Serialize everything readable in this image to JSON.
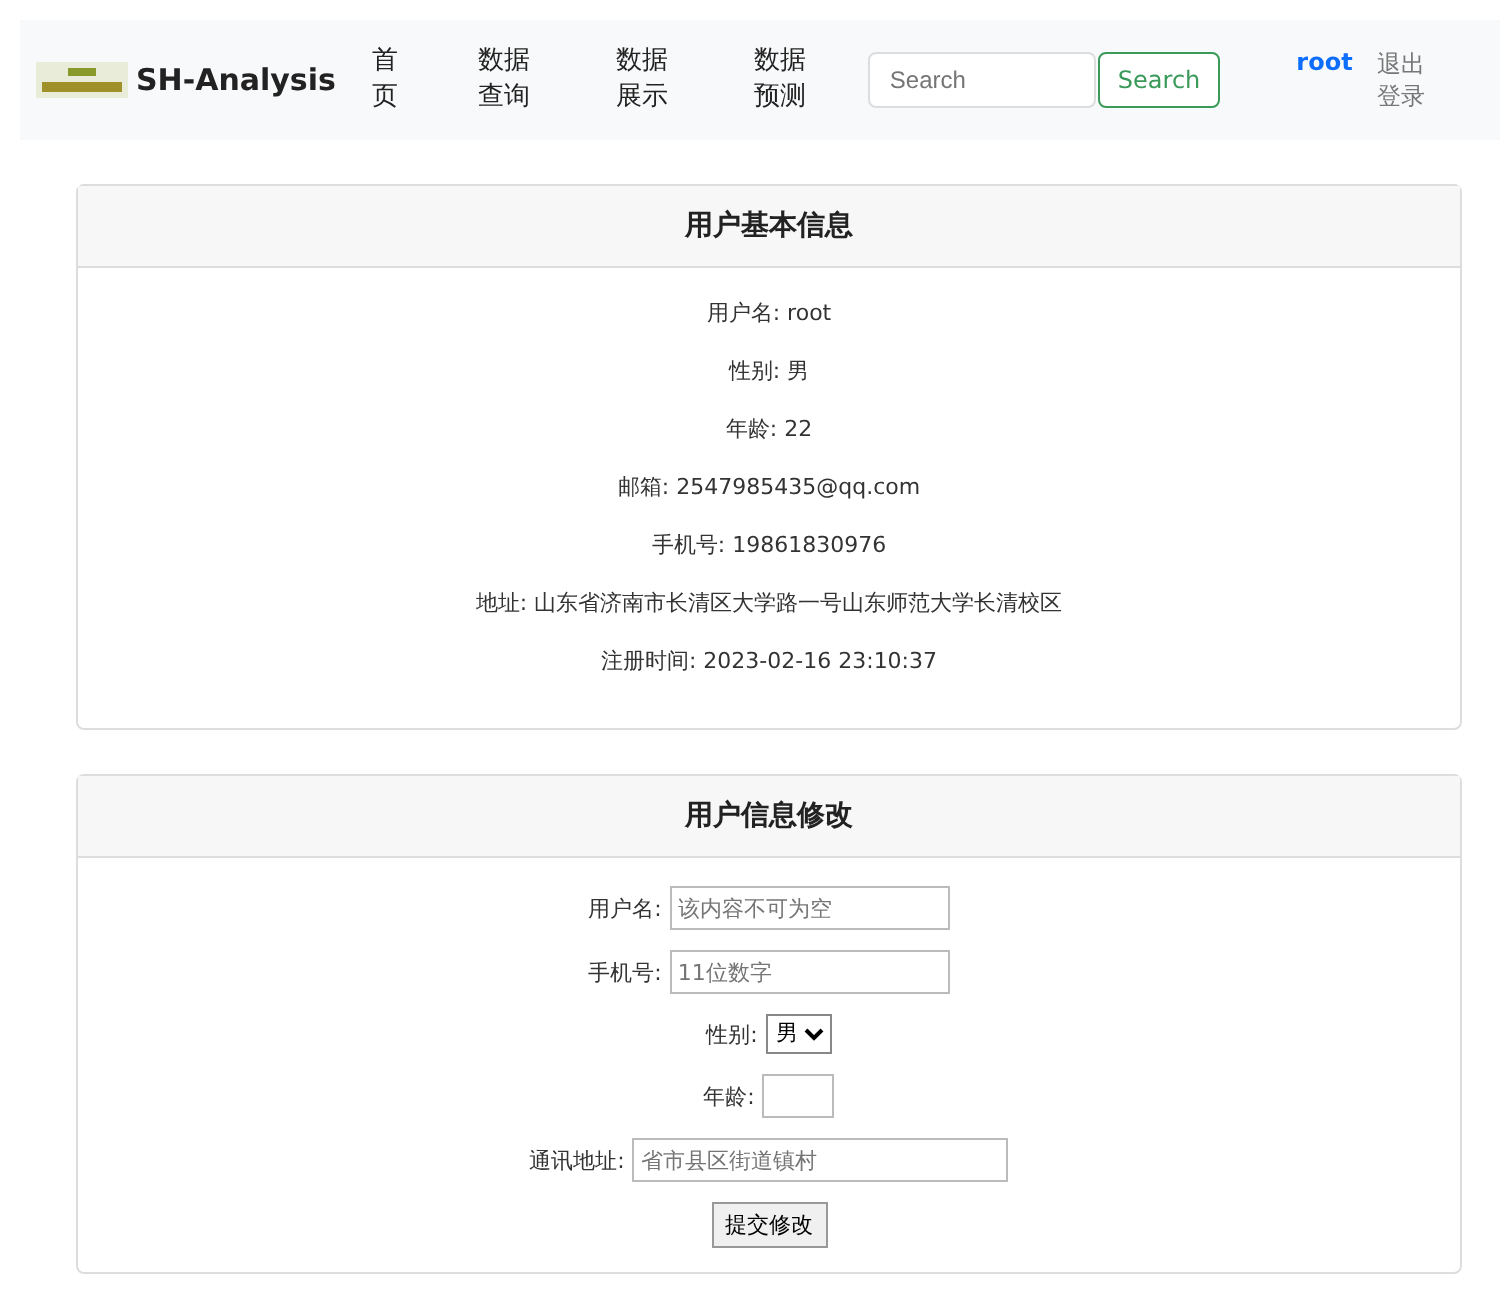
{
  "navbar": {
    "brand": "SH-Analysis",
    "nav_items": [
      {
        "label": "首页",
        "selected": false
      },
      {
        "label": "数据查询",
        "selected": false
      },
      {
        "label": "数据展示",
        "selected": false
      },
      {
        "label": "数据预测",
        "selected": false
      }
    ],
    "search": {
      "placeholder": "Search",
      "button": "Search"
    },
    "user": "root",
    "logout": "退出登录"
  },
  "info_card": {
    "title": "用户基本信息",
    "lines": [
      "用户名: root",
      "性别: 男",
      "年龄: 22",
      "邮箱: 2547985435@qq.com",
      "手机号: 19861830976",
      "地址: 山东省济南市长清区大学路一号山东师范大学长清校区",
      "注册时间: 2023-02-16 23:10:37"
    ]
  },
  "edit_card": {
    "title": "用户信息修改",
    "fields": [
      {
        "kind": "text",
        "label": "用户名:",
        "placeholder": "该内容不可为空"
      },
      {
        "kind": "text",
        "label": "手机号:",
        "placeholder": "11位数字"
      },
      {
        "kind": "select",
        "label": "性别:",
        "value": "男"
      },
      {
        "kind": "small",
        "label": "年龄:"
      },
      {
        "kind": "wide",
        "label": "通讯地址:",
        "placeholder": "省市县区街道镇村"
      }
    ],
    "submit": "提交修改"
  }
}
